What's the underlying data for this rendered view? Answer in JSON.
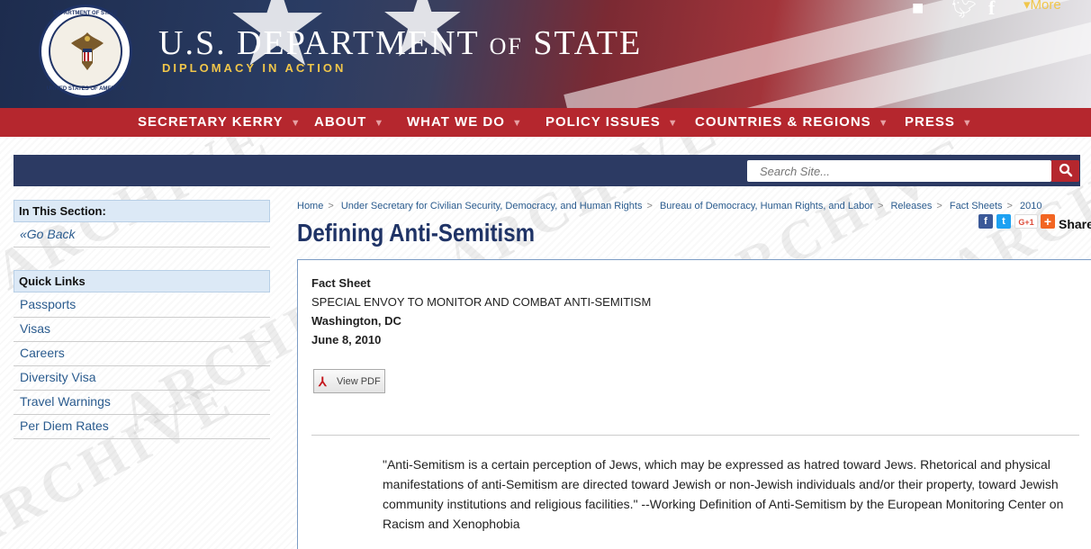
{
  "header": {
    "title_main": "U.S. DEPARTMENT",
    "title_of": "OF",
    "title_end": "STATE",
    "tagline": "DIPLOMACY IN ACTION",
    "seal_top_text": "DEPARTMENT OF STATE",
    "seal_bottom_text": "UNITED STATES OF AMERICA",
    "social": {
      "video_icon": "video-camera-icon",
      "twitter_icon": "twitter-icon",
      "facebook_icon": "facebook-icon"
    },
    "more_label": "More"
  },
  "nav": {
    "items": [
      {
        "label": "SECRETARY KERRY"
      },
      {
        "label": "ABOUT"
      },
      {
        "label": "WHAT WE DO"
      },
      {
        "label": "POLICY ISSUES"
      },
      {
        "label": "COUNTRIES & REGIONS"
      },
      {
        "label": "PRESS"
      }
    ]
  },
  "watermark": "ARCHIVE",
  "search": {
    "placeholder": "Search Site...",
    "button_icon": "search-icon"
  },
  "sidebar": {
    "section_heading": "In This Section:",
    "go_back": "Go Back",
    "quick_links_heading": "Quick Links",
    "links": [
      "Passports",
      "Visas",
      "Careers",
      "Diversity Visa",
      "Travel Warnings",
      "Per Diem Rates"
    ]
  },
  "breadcrumb": [
    "Home",
    "Under Secretary for Civilian Security, Democracy, and Human Rights",
    "Bureau of Democracy, Human Rights, and Labor",
    "Releases",
    "Fact Sheets",
    "2010"
  ],
  "page_title": "Defining Anti-Semitism",
  "share": {
    "label": "Share",
    "facebook": "f",
    "twitter": "t",
    "gplus": "G+1",
    "plus": "+"
  },
  "doc": {
    "type": "Fact Sheet",
    "office": "SPECIAL ENVOY TO MONITOR AND COMBAT ANTI-SEMITISM",
    "place": "Washington, DC",
    "date": "June 8, 2010",
    "pdf_label": "View PDF",
    "quote": "\"Anti-Semitism is a certain perception of Jews, which may be expressed as hatred toward Jews. Rhetorical and physical manifestations of anti-Semitism are directed toward Jewish or non-Jewish individuals and/or their property, toward Jewish community institutions and religious facilities.\" --Working Definition of Anti-Semitism by the European Monitoring Center on Racism and Xenophobia"
  },
  "colors": {
    "nav_red": "#b5272e",
    "navy": "#2c3a63",
    "title_blue": "#1f3366",
    "link_blue": "#2a5b8e",
    "gold": "#f0c64a"
  }
}
